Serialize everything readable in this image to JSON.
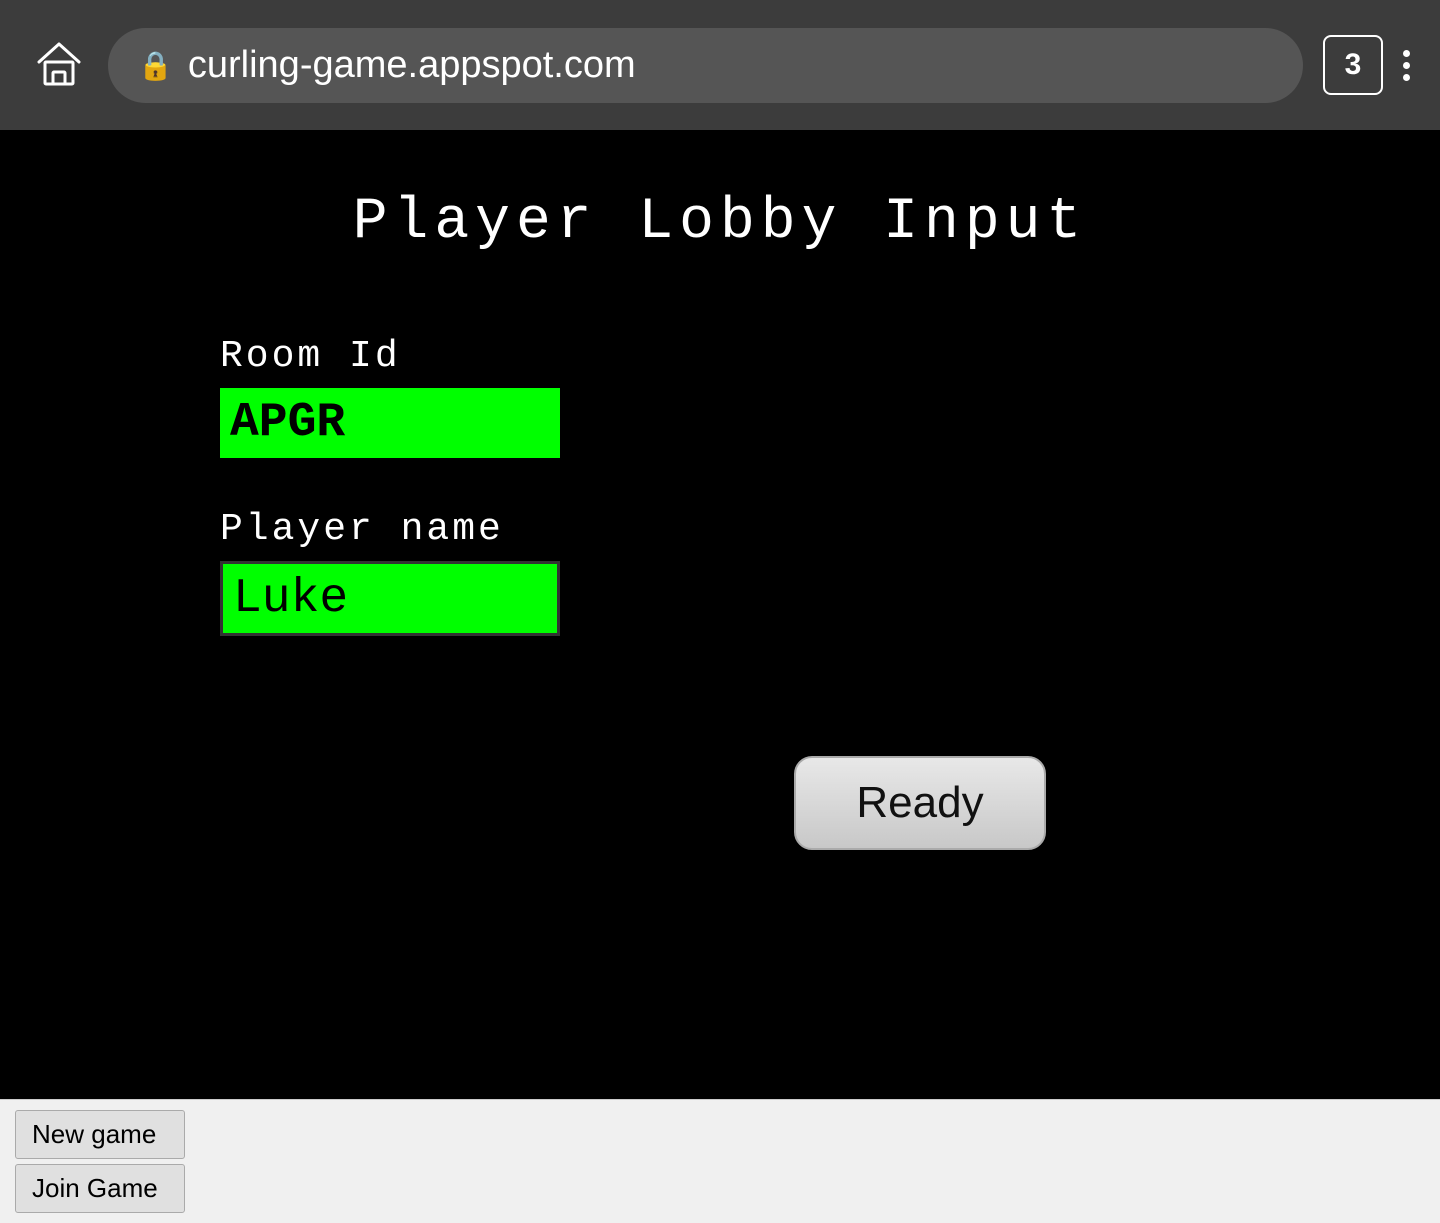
{
  "browser": {
    "url": "curling-game.appspot.com",
    "tab_count": "3"
  },
  "game": {
    "title": "Player  Lobby  Input",
    "room_id_label": "Room Id",
    "room_id_value": "APGR",
    "player_name_label": "Player name",
    "player_name_value": "Luke",
    "ready_button_label": "Ready"
  },
  "bottom_bar": {
    "new_game_label": "New game",
    "join_game_label": "Join Game"
  }
}
